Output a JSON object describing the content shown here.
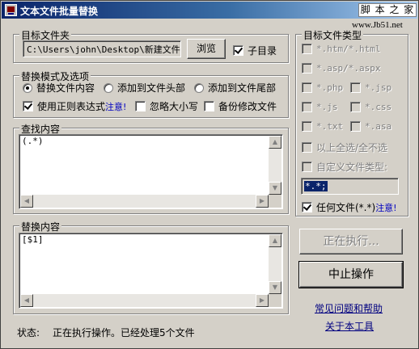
{
  "window": {
    "title": "文本文件批量替换"
  },
  "watermark": {
    "text": "脚 本 之 家",
    "url": "www.Jb51.net"
  },
  "target_folder": {
    "legend": "目标文件夹",
    "path": "C:\\Users\\john\\Desktop\\新建文件夹",
    "browse_label": "浏览",
    "subdir_label": "子目录",
    "subdir_checked": true
  },
  "mode": {
    "legend": "替换模式及选项",
    "radio_replace": "替换文件内容",
    "radio_head": "添加到文件头部",
    "radio_tail": "添加到文件尾部",
    "selected": "replace",
    "regex_label": "使用正则表达式",
    "regex_note": "注意!",
    "regex_checked": true,
    "ignore_case_label": "忽略大小写",
    "backup_label": "备份修改文件"
  },
  "find": {
    "legend": "查找内容",
    "value": "(.*)"
  },
  "replace": {
    "legend": "替换内容",
    "value": "[$1]"
  },
  "file_types": {
    "legend": "目标文件类型",
    "items": [
      {
        "label": "*.htm/*.html"
      },
      {
        "label": "*.asp/*.aspx"
      },
      {
        "label": "*.php"
      },
      {
        "label": "*.jsp"
      },
      {
        "label": "*.js"
      },
      {
        "label": "*.css"
      },
      {
        "label": "*.txt"
      },
      {
        "label": "*.asa"
      }
    ],
    "select_all_label": "以上全选/全不选",
    "custom_label": "自定义文件类型:",
    "custom_value": "*.*;",
    "any_label": "任何文件(*.*)",
    "any_note": "注意!",
    "any_checked": true
  },
  "buttons": {
    "running": "正在执行...",
    "stop": "中止操作"
  },
  "links": {
    "help": "常见问题和帮助",
    "about": "关于本工具"
  },
  "status": {
    "label": "状态:",
    "text": "正在执行操作。已经处理5个文件"
  }
}
